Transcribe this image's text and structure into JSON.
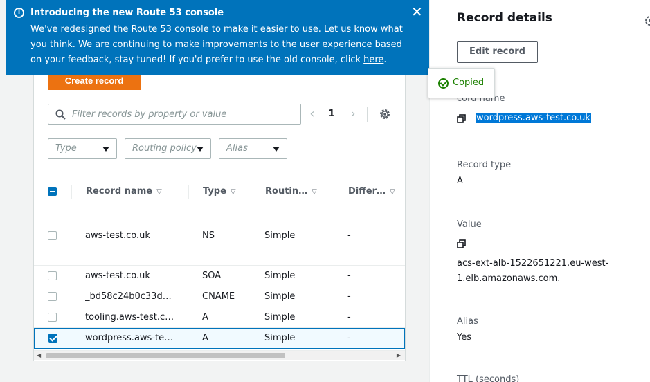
{
  "banner": {
    "title": "Introducing the new Route 53 console",
    "body_part1": "We've redesigned the Route 53 console to make it easier to use. ",
    "link1": "Let us know what you think",
    "body_part2": ". We are continuing to make improvements to the user experience based on your feedback, stay tuned! If you'd prefer to use the old console, click ",
    "link2": "here",
    "body_part3": ".",
    "close_icon": "close-icon",
    "info_icon": "i"
  },
  "toolbar": {
    "create_label": "Create record",
    "search_placeholder": "Filter records by property or value",
    "page_number": "1",
    "prev": "‹",
    "next": "›"
  },
  "filters": {
    "type": "Type",
    "routing": "Routing policy",
    "alias": "Alias"
  },
  "table": {
    "columns": [
      "Record name",
      "Type",
      "Routin…",
      "Differ…"
    ],
    "sort_glyph": "▽",
    "rows": [
      {
        "name": "aws-test.co.uk",
        "type": "NS",
        "routing": "Simple",
        "diff": "-",
        "checked": false
      },
      {
        "name": "aws-test.co.uk",
        "type": "SOA",
        "routing": "Simple",
        "diff": "-",
        "checked": false
      },
      {
        "name": "_bd58c24b0c33d…",
        "type": "CNAME",
        "routing": "Simple",
        "diff": "-",
        "checked": false
      },
      {
        "name": "tooling.aws-test.c…",
        "type": "A",
        "routing": "Simple",
        "diff": "-",
        "checked": false
      },
      {
        "name": "wordpress.aws-te…",
        "type": "A",
        "routing": "Simple",
        "diff": "-",
        "checked": true
      }
    ]
  },
  "details": {
    "title": "Record details",
    "edit_label": "Edit record",
    "copied_label": "Copied",
    "record_name_label": "cord name",
    "record_name_value": "wordpress.aws-test.co.uk",
    "record_type_label": "Record type",
    "record_type_value": "A",
    "value_label": "Value",
    "value_line1": "acs-ext-alb-1522651221.eu-west-",
    "value_line2": "1.elb.amazonaws.com.",
    "alias_label": "Alias",
    "alias_value": "Yes",
    "ttl_label": "TTL (seconds)"
  },
  "colors": {
    "banner": "#0073bb",
    "primary_button": "#ec7211",
    "selection": "#0078d7",
    "success": "#1d8102"
  }
}
